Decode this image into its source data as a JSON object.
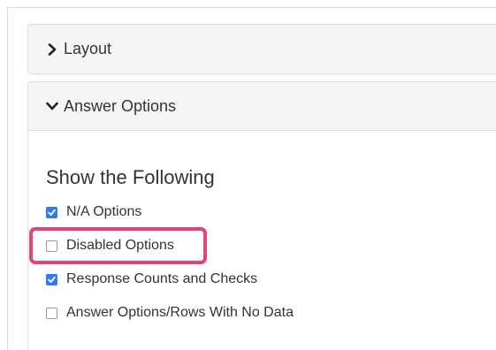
{
  "sections": {
    "layout": {
      "title": "Layout",
      "state": "collapsed",
      "icon": "chevron-right-icon"
    },
    "answer_options": {
      "title": "Answer Options",
      "state": "expanded",
      "icon": "chevron-down-icon",
      "subheading": "Show the Following",
      "options": [
        {
          "label": "N/A Options",
          "checked": true
        },
        {
          "label": "Disabled Options",
          "checked": false,
          "highlighted": true
        },
        {
          "label": "Response Counts and Checks",
          "checked": true
        },
        {
          "label": "Answer Options/Rows With No Data",
          "checked": false
        }
      ]
    }
  },
  "colors": {
    "checkbox_checked": "#2f7ee6",
    "highlight_border": "#e0457b",
    "header_bg": "#f5f5f5"
  }
}
